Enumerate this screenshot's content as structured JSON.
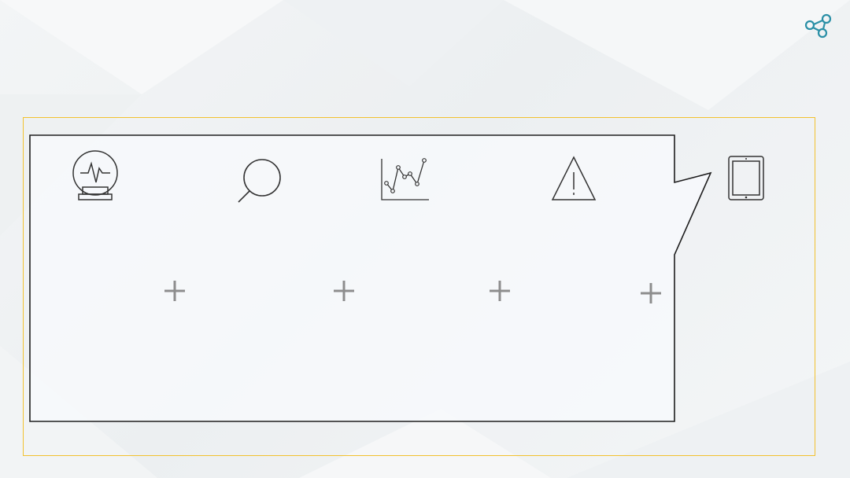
{
  "colors": {
    "frame_border": "#f2c12e",
    "callout_border": "#1e1e1e",
    "callout_fill": "#f7f9fb",
    "icon_stroke": "#333333",
    "plus_color": "#8d8d8d",
    "logo_color": "#2a8fa6"
  },
  "icons": [
    "crystal-ball-icon",
    "magnifier-icon",
    "line-chart-icon",
    "warning-icon",
    "tablet-icon"
  ],
  "plus_signs": 4
}
